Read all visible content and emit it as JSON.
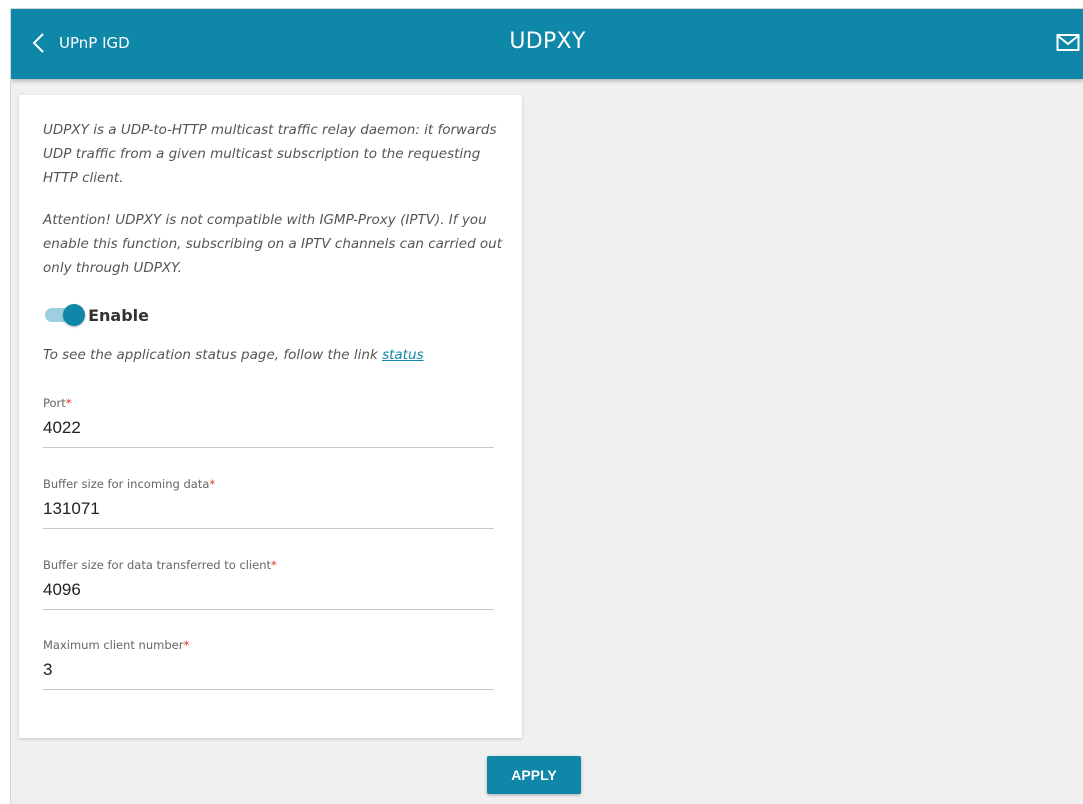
{
  "header": {
    "back_label": "UPnP IGD",
    "title": "UDPXY",
    "accent_color": "#0e87a8"
  },
  "content": {
    "description": "UDPXY is a UDP-to-HTTP multicast traffic relay daemon: it forwards UDP traffic from a given multicast subscription to the requesting HTTP client.",
    "attention": "Attention! UDPXY is not compatible with IGMP-Proxy (IPTV). If you enable this function, subscribing on a IPTV channels can carried out only through UDPXY.",
    "enable_label": "Enable",
    "enable_state": true,
    "status_text": "To see the application status page, follow the link ",
    "status_link": "status"
  },
  "fields": {
    "port": {
      "label": "Port",
      "value": "4022"
    },
    "buffer_in": {
      "label": "Buffer size for incoming data",
      "value": "131071"
    },
    "buffer_out": {
      "label": "Buffer size for data transferred to client",
      "value": "4096"
    },
    "max_clients": {
      "label": "Maximum client number",
      "value": "3"
    },
    "required_mark": "*"
  },
  "actions": {
    "apply_label": "APPLY"
  },
  "icons": {
    "back": "chevron-left-icon",
    "notifications": "mail-icon"
  }
}
